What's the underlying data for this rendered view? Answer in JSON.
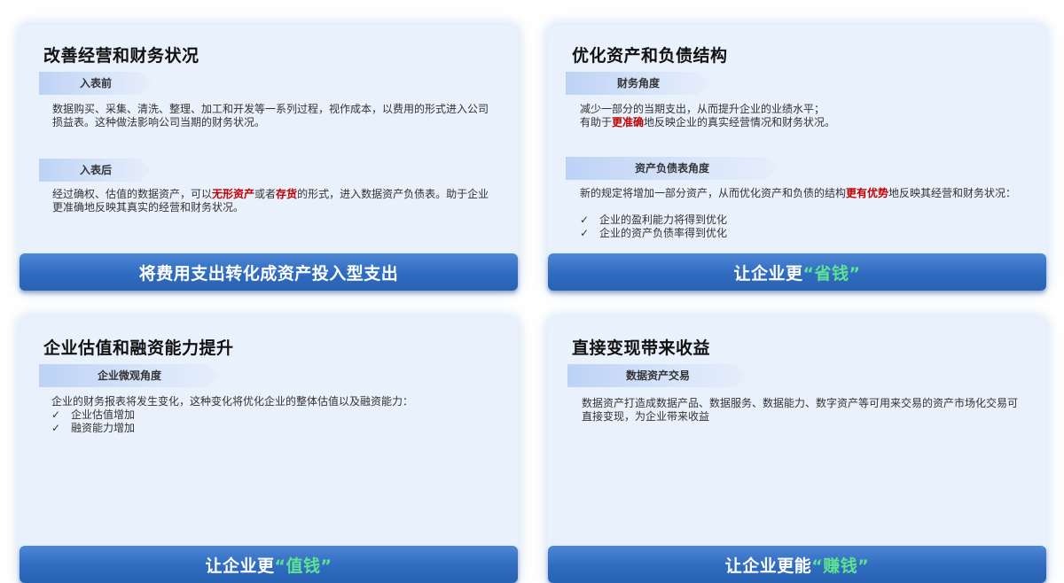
{
  "cards": [
    {
      "title": "改善经营和财务状况",
      "sections": [
        {
          "tag": "入表前",
          "text": "数据购买、采集、清洗、整理、加工和开发等一系列过程，视作成本，以费用的形式进入公司损益表。这种做法影响公司当期的财务状况。"
        },
        {
          "tag": "入表后",
          "text_parts": [
            "经过确权、估值的数据资产，可以",
            "无形资产",
            "或者",
            "存货",
            "的形式，进入数据资产负债表。助于企业更准确地反映其真实的经营和财务状况。"
          ]
        }
      ],
      "banner": "将费用支出转化成资产投入型支出"
    },
    {
      "title": "优化资产和负债结构",
      "sections": [
        {
          "tag": "财务角度",
          "line1": "减少一部分的当期支出，从而提升企业的业绩水平；",
          "line2_parts": [
            "有助于",
            "更准确",
            "地反映企业的真实经营情况和财务状况。"
          ]
        },
        {
          "tag": "资产负债表角度",
          "text_parts": [
            "新的规定将增加一部分资产，从而优化资产和负债的结构",
            "更有优势",
            "地反映其经营和财务状况："
          ],
          "checks": [
            "企业的盈利能力将得到优化",
            "企业的资产负债率得到优化"
          ]
        }
      ],
      "banner_prefix": "让企业更",
      "banner_highlight": "“省钱”"
    },
    {
      "title": "企业估值和融资能力提升",
      "sections": [
        {
          "tag": "企业微观角度",
          "text": "企业的财务报表将发生变化，这种变化将优化企业的整体估值以及融资能力：",
          "checks": [
            "企业估值增加",
            "融资能力增加"
          ]
        }
      ],
      "banner_prefix": "让企业更",
      "banner_highlight": "“值钱”"
    },
    {
      "title": "直接变现带来收益",
      "sections": [
        {
          "tag": "数据资产交易",
          "text": "数据资产打造成数据产品、数据服务、数据能力、数字资产等可用来交易的资产市场化交易可直接变现，为企业带来收益"
        }
      ],
      "banner_prefix": "让企业更能",
      "banner_highlight": "“赚钱”"
    }
  ],
  "check_symbol": "✓",
  "colors": {
    "banner": "#2f6bbf",
    "highlight_red": "#c00000",
    "highlight_green": "#5ee390",
    "card_bg": "#e9f1fc"
  }
}
